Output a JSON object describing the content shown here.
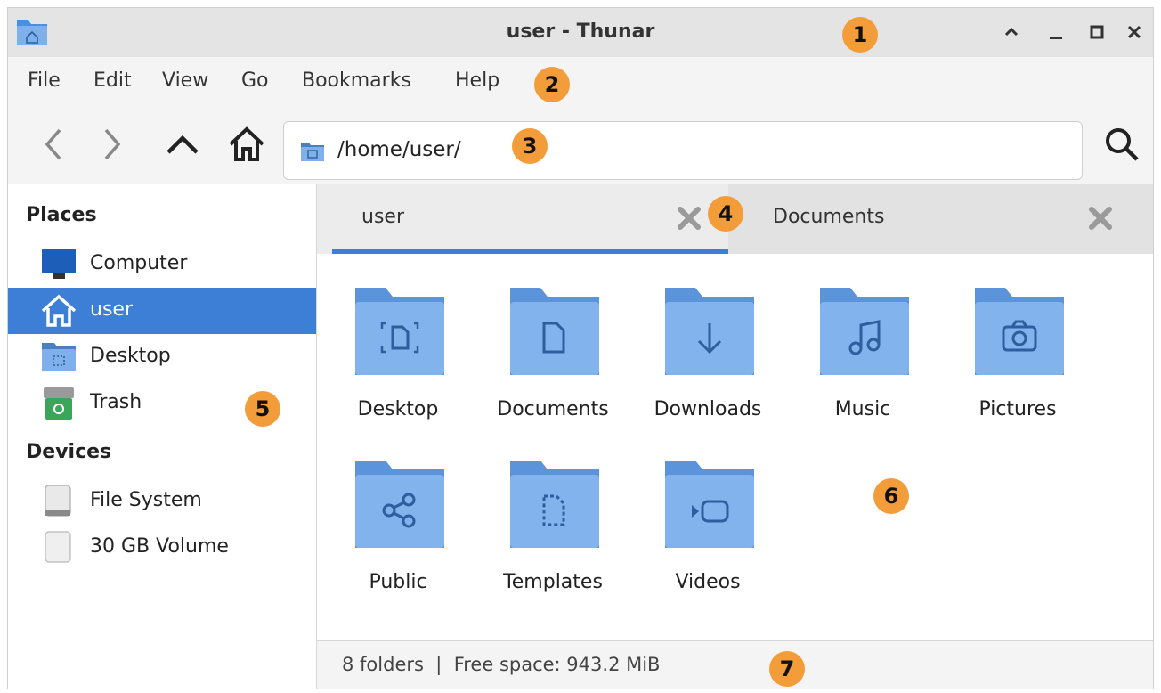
{
  "window": {
    "title": "user - Thunar",
    "icons": {
      "app": "folder-home-icon",
      "collapse": "chevron-up-icon",
      "minimize": "minimize-icon",
      "maximize": "maximize-icon",
      "close": "close-icon"
    }
  },
  "menubar": {
    "items": [
      "File",
      "Edit",
      "View",
      "Go",
      "Bookmarks",
      "Help"
    ]
  },
  "toolbar": {
    "path": "/home/user/",
    "icons": {
      "back": "arrow-left-icon",
      "forward": "arrow-right-icon",
      "up": "arrow-up-icon",
      "home": "home-icon",
      "search": "search-icon"
    }
  },
  "sidebar": {
    "places_heading": "Places",
    "places": [
      {
        "label": "Computer",
        "icon": "computer-icon"
      },
      {
        "label": "user",
        "icon": "home-icon",
        "selected": true
      },
      {
        "label": "Desktop",
        "icon": "desktop-folder-icon"
      },
      {
        "label": "Trash",
        "icon": "trash-icon"
      }
    ],
    "devices_heading": "Devices",
    "devices": [
      {
        "label": "File System",
        "icon": "drive-icon"
      },
      {
        "label": "30 GB Volume",
        "icon": "drive-icon"
      }
    ]
  },
  "tabs": [
    {
      "label": "user",
      "active": true
    },
    {
      "label": "Documents",
      "active": false
    }
  ],
  "folders": [
    {
      "label": "Desktop",
      "icon": "desktop-folder-icon"
    },
    {
      "label": "Documents",
      "icon": "documents-folder-icon"
    },
    {
      "label": "Downloads",
      "icon": "downloads-folder-icon"
    },
    {
      "label": "Music",
      "icon": "music-folder-icon"
    },
    {
      "label": "Pictures",
      "icon": "pictures-folder-icon"
    },
    {
      "label": "Public",
      "icon": "public-folder-icon"
    },
    {
      "label": "Templates",
      "icon": "templates-folder-icon"
    },
    {
      "label": "Videos",
      "icon": "videos-folder-icon"
    }
  ],
  "statusbar": {
    "text": "8 folders  |  Free space: 943.2 MiB"
  },
  "annotations": [
    "1",
    "2",
    "3",
    "4",
    "5",
    "6",
    "7"
  ],
  "colors": {
    "accent": "#3d7fd6",
    "badge": "#f39c3a",
    "folder": "#7fb0ea"
  }
}
